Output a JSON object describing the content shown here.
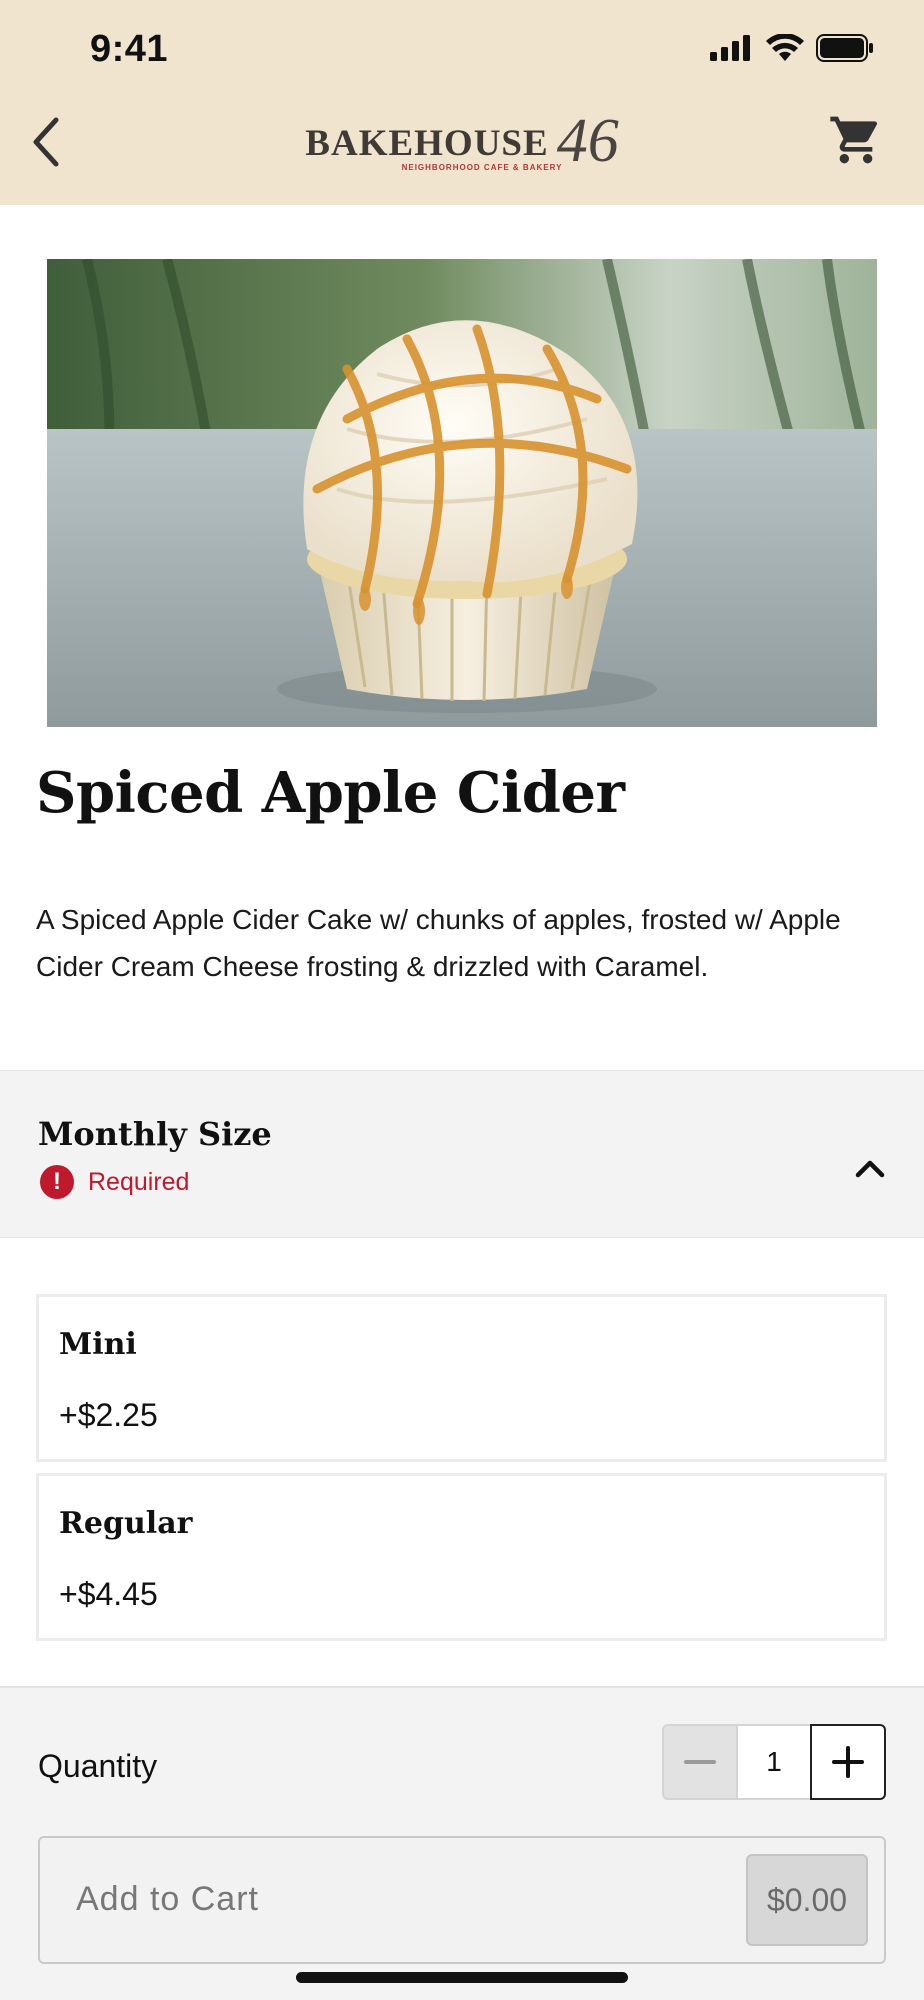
{
  "status_bar": {
    "time": "9:41",
    "icons": [
      "signal-icon",
      "wifi-icon",
      "battery-icon"
    ]
  },
  "header": {
    "logo_text": "BAKEHOUSE",
    "logo_number": "46",
    "logo_tagline": "NEIGHBORHOOD CAFE & BAKERY",
    "back_icon": "chevron-left-icon",
    "cart_icon": "cart-icon",
    "background": "#f0e4cf"
  },
  "product": {
    "image": "cupcake-photo",
    "title": "Spiced Apple Cider",
    "description": "A Spiced Apple Cider Cake w/ chunks of apples, frosted w/ Apple Cider Cream Cheese frosting & drizzled with Caramel."
  },
  "options_section": {
    "title": "Monthly Size",
    "required_label": "Required",
    "required_icon": "alert-icon",
    "collapse_icon": "chevron-up-icon",
    "required_color": "#c0182c",
    "options": [
      {
        "name": "Mini",
        "price": "+$2.25"
      },
      {
        "name": "Regular",
        "price": "+$4.45"
      }
    ]
  },
  "footer": {
    "quantity_label": "Quantity",
    "quantity_value": "1",
    "add_to_cart_label": "Add to Cart",
    "total": "$0.00"
  }
}
